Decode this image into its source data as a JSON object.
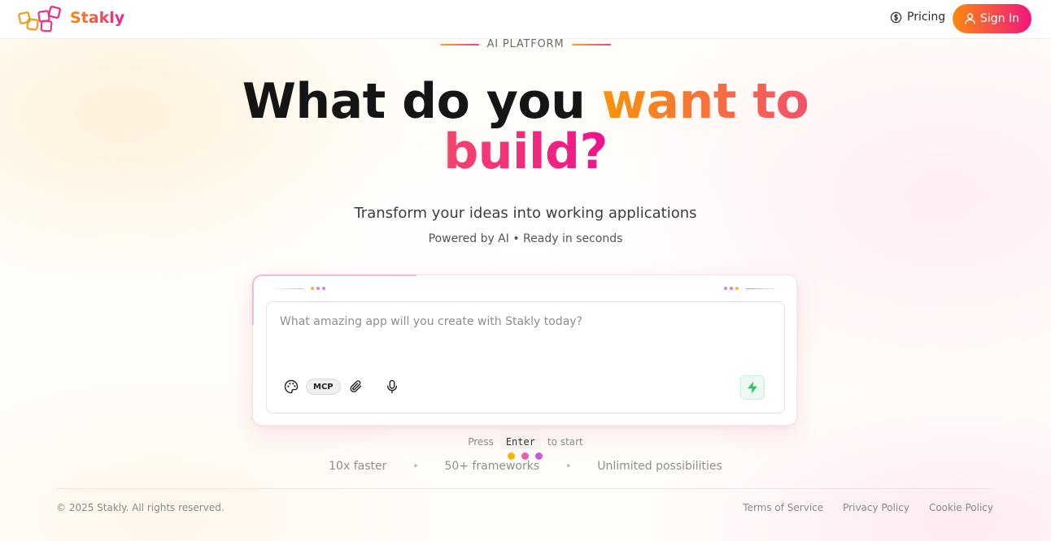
{
  "header": {
    "brand": "Stakly",
    "pricing_label": "Pricing",
    "signin_label": "Sign In"
  },
  "hero": {
    "eyebrow": "AI PLATFORM",
    "headline_plain": "What do you",
    "headline_accent1": "want to",
    "headline_accent2": "build?",
    "subtitle": "Transform your ideas into working applications",
    "tagline": "Powered by AI • Ready in seconds"
  },
  "prompt": {
    "placeholder": "What amazing app will you create with Stakly today?",
    "value": "",
    "mcp_label": "MCP",
    "press_label": "Press",
    "key_label": "Enter",
    "to_start_label": "to start"
  },
  "stats": [
    "10x faster",
    "50+ frameworks",
    "Unlimited possibilities"
  ],
  "stats_separator": "•",
  "footer": {
    "copyright": "© 2025 Stakly. All rights reserved.",
    "links": [
      "Terms of Service",
      "Privacy Policy",
      "Cookie Policy"
    ]
  },
  "colors": {
    "brand_orange": "#f98a10",
    "brand_pink": "#f2157f",
    "submit_green": "#22c55e",
    "loader_dots": [
      "#f6b400",
      "#e85fb0",
      "#c65bd9"
    ]
  },
  "icons": {
    "pricing": "dollar-circle-icon",
    "signin": "user-icon",
    "palette": "palette-icon",
    "attach": "paperclip-icon",
    "mic": "microphone-icon",
    "submit": "lightning-icon"
  }
}
